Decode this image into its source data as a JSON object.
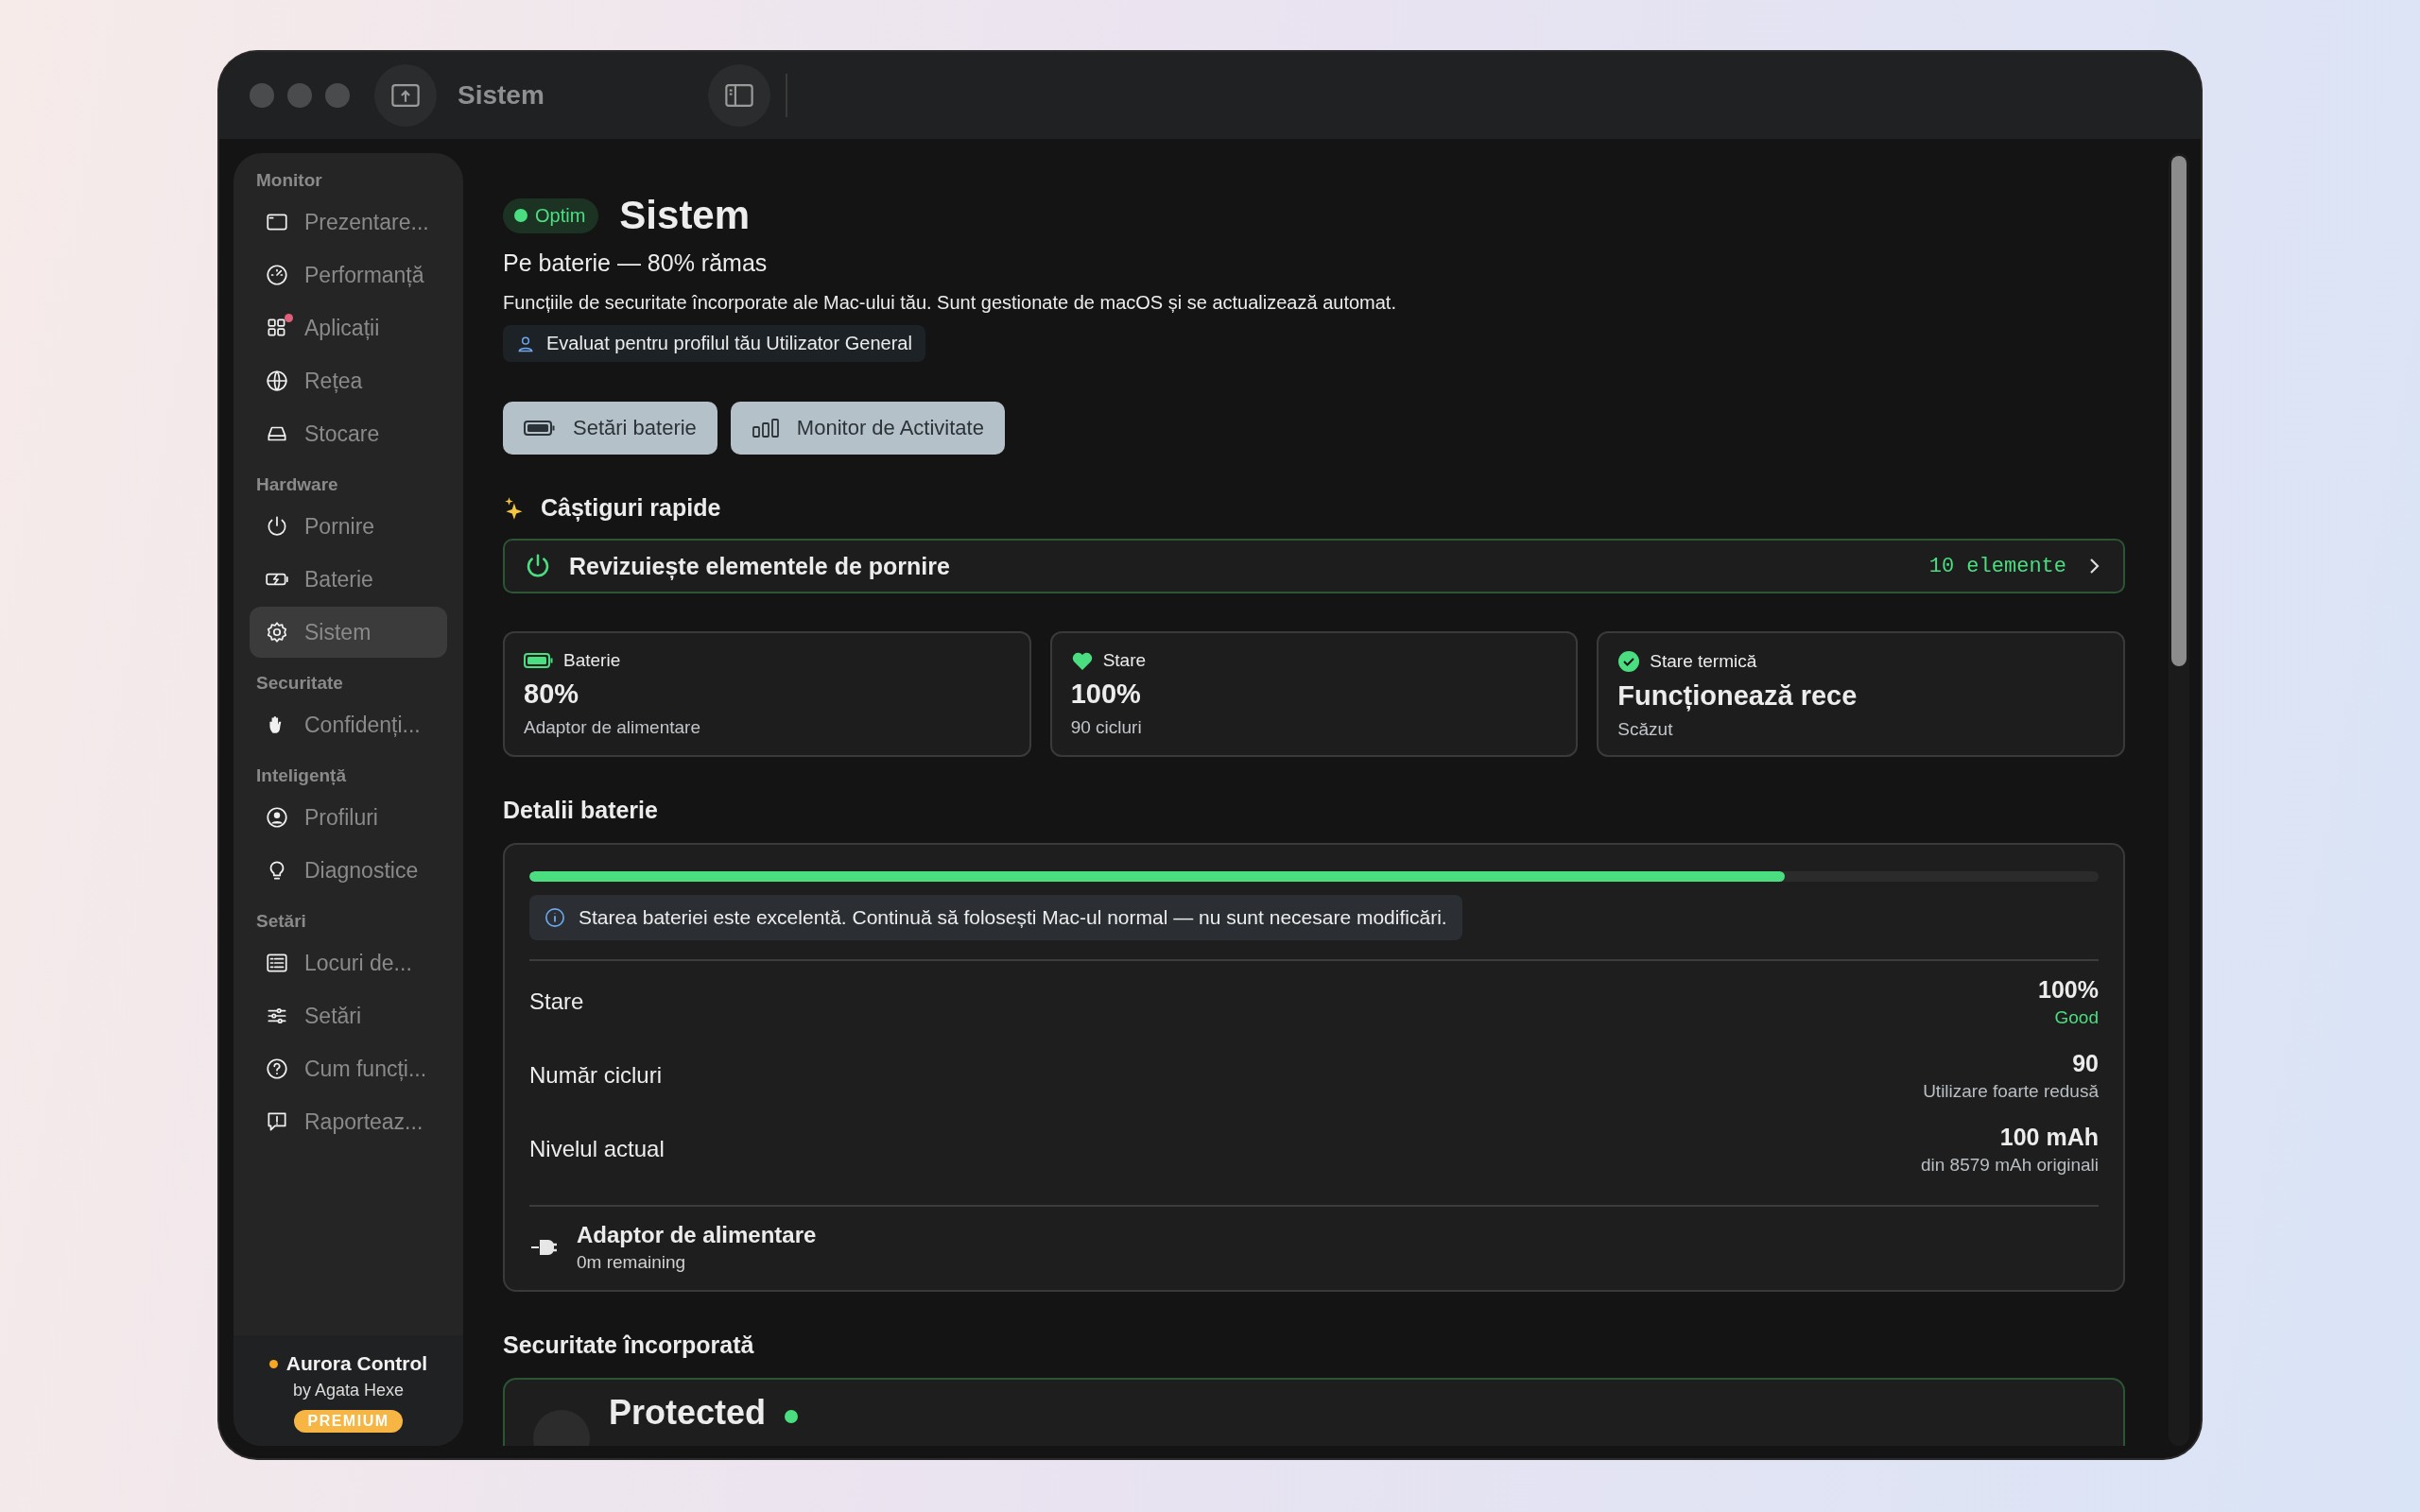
{
  "window": {
    "title": "Sistem"
  },
  "sidebar": {
    "sections": [
      {
        "label": "Monitor",
        "items": [
          {
            "label": "Prezentare...",
            "selected": false,
            "dot": false
          },
          {
            "label": "Performanță",
            "selected": false,
            "dot": false
          },
          {
            "label": "Aplicații",
            "selected": false,
            "dot": true
          },
          {
            "label": "Rețea",
            "selected": false,
            "dot": false
          },
          {
            "label": "Stocare",
            "selected": false,
            "dot": false
          }
        ]
      },
      {
        "label": "Hardware",
        "items": [
          {
            "label": "Pornire",
            "selected": false,
            "dot": false
          },
          {
            "label": "Baterie",
            "selected": false,
            "dot": false
          },
          {
            "label": "Sistem",
            "selected": true,
            "dot": false
          }
        ]
      },
      {
        "label": "Securitate",
        "items": [
          {
            "label": "Confidenți...",
            "selected": false,
            "dot": false
          }
        ]
      },
      {
        "label": "Inteligență",
        "items": [
          {
            "label": "Profiluri",
            "selected": false,
            "dot": false
          },
          {
            "label": "Diagnostice",
            "selected": false,
            "dot": false
          }
        ]
      },
      {
        "label": "Setări",
        "items": [
          {
            "label": "Locuri de...",
            "selected": false,
            "dot": false
          },
          {
            "label": "Setări",
            "selected": false,
            "dot": false
          },
          {
            "label": "Cum funcți...",
            "selected": false,
            "dot": false
          },
          {
            "label": "Raporteaz...",
            "selected": false,
            "dot": false
          }
        ]
      }
    ],
    "footer": {
      "app": "Aurora Control",
      "author": "by Agata Hexe",
      "badge": "PREMIUM"
    }
  },
  "header": {
    "status": "Optim",
    "title": "Sistem",
    "subtitle": "Pe baterie — 80% rămas",
    "description": "Funcțiile de securitate încorporate ale Mac-ului tău. Sunt gestionate de macOS și se actualizează automat.",
    "profile_chip": "Evaluat pentru profilul tău Utilizator General"
  },
  "buttons": [
    "Setări baterie",
    "Monitor de Activitate"
  ],
  "quick_wins": {
    "title": "Câștiguri rapide",
    "items": [
      {
        "label": "Revizuiește elementele de pornire",
        "count": "10 elemente"
      }
    ]
  },
  "cards": [
    {
      "label": "Baterie",
      "value": "80%",
      "detail": "Adaptor de alimentare"
    },
    {
      "label": "Stare",
      "value": "100%",
      "detail": "90 cicluri"
    },
    {
      "label": "Stare termică",
      "value": "Funcționează rece",
      "detail": "Scăzut"
    }
  ],
  "battery_details": {
    "title": "Detalii baterie",
    "level": 0.8,
    "info": "Starea bateriei este excelentă. Continuă să folosești Mac-ul normal — nu sunt necesare modificări.",
    "rows": [
      {
        "label": "Stare",
        "value": "100%",
        "note": "Good",
        "color": "#4ade80"
      },
      {
        "label": "Număr cicluri",
        "value": "90",
        "note": "Utilizare foarte redusă",
        "color": "#b9bec3"
      },
      {
        "label": "Nivelul actual",
        "value": "100 mAh",
        "note": "din 8579 mAh originali",
        "color": "#b9bec3"
      }
    ],
    "power": {
      "title": "Adaptor de alimentare",
      "subtitle": "0m remaining"
    }
  },
  "security": {
    "title": "Securitate încorporată",
    "status": "Protected"
  }
}
